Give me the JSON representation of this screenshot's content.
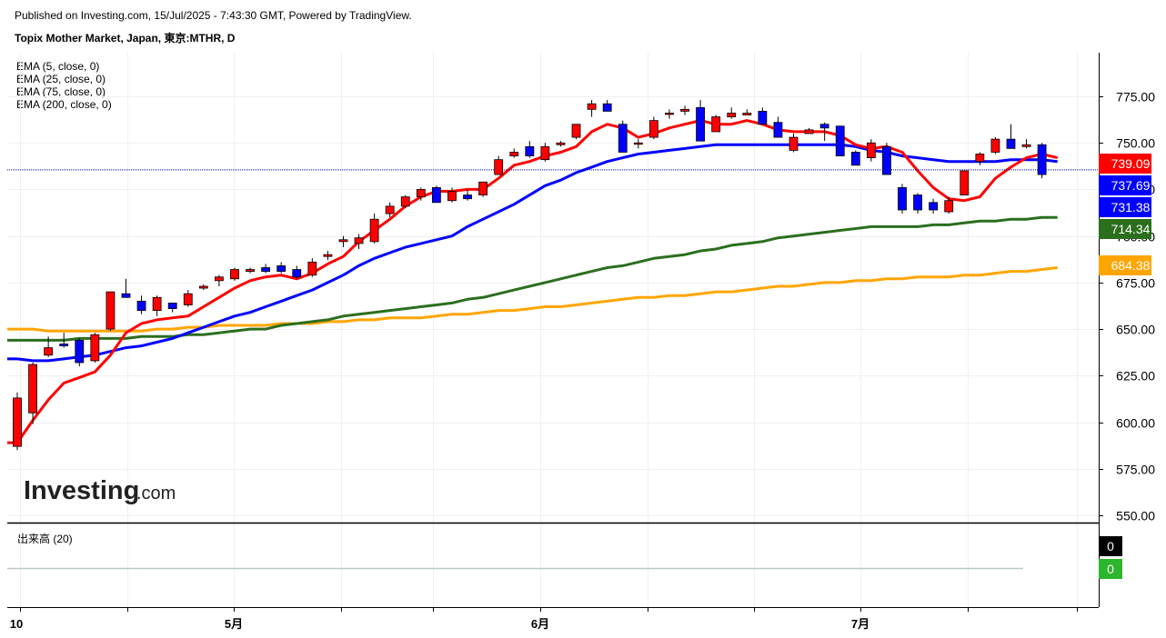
{
  "header": {
    "published": "Published on Investing.com, 15/Jul/2025 - 7:43:30 GMT, Powered by TradingView.",
    "symbol": "Topix Mother Market, Japan, 東京:MTHR, D"
  },
  "watermark": {
    "brand": "Investing",
    "suffix": ".com"
  },
  "legend": [
    "EMA (5, close, 0)",
    "EMA (25, close, 0)",
    "EMA (75, close, 0)",
    "EMA (200, close, 0)"
  ],
  "volume": {
    "label": "出来高 (20)",
    "badges": [
      "0",
      "0"
    ]
  },
  "colors": {
    "up": "#ff0000",
    "down": "#0000ff",
    "ema5": "#ff0000",
    "ema25": "#0000ff",
    "ema75": "#2b6e1e",
    "ema200": "#ffa500",
    "vol_badge_1": "#000000",
    "vol_badge_2": "#2db52d"
  },
  "chart_data": {
    "type": "candlestick",
    "y_ticks": [
      550,
      575,
      600,
      625,
      650,
      675,
      700,
      725,
      750,
      775
    ],
    "y_tick_labels": [
      "550.00",
      "575.00",
      "600.00",
      "625.00",
      "650.00",
      "675.00",
      "700.00",
      "725.00",
      "750.00",
      "775.00"
    ],
    "x_labels": [
      {
        "label": "10",
        "date": "2025-04-10"
      },
      {
        "label": "5月",
        "date": "2025-05-01"
      },
      {
        "label": "6月",
        "date": "2025-06-02"
      },
      {
        "label": "7月",
        "date": "2025-07-01"
      }
    ],
    "candles": [
      [
        587,
        616,
        585,
        613
      ],
      [
        605,
        632,
        599,
        631
      ],
      [
        636,
        646,
        635,
        640
      ],
      [
        642,
        648,
        640,
        641
      ],
      [
        644,
        645,
        630,
        632
      ],
      [
        633,
        648,
        632,
        647
      ],
      [
        650,
        670,
        649,
        670
      ],
      [
        669,
        677,
        667,
        667
      ],
      [
        665,
        668,
        658,
        660
      ],
      [
        660,
        668,
        657,
        667
      ],
      [
        664,
        664,
        659,
        661
      ],
      [
        663,
        671,
        662,
        669
      ],
      [
        672,
        674,
        671,
        673
      ],
      [
        676,
        679,
        673,
        678
      ],
      [
        677,
        683,
        676,
        682
      ],
      [
        681,
        683,
        680,
        682
      ],
      [
        683,
        685,
        680,
        681
      ],
      [
        684,
        686,
        680,
        681
      ],
      [
        682,
        684,
        677,
        678
      ],
      [
        679,
        688,
        678,
        686
      ],
      [
        689,
        692,
        687,
        690
      ],
      [
        697,
        700,
        694,
        698
      ],
      [
        696,
        701,
        693,
        699
      ],
      [
        697,
        712,
        696,
        709
      ],
      [
        712,
        718,
        710,
        716
      ],
      [
        716,
        722,
        715,
        721
      ],
      [
        721,
        726,
        719,
        725
      ],
      [
        726,
        727,
        718,
        718
      ],
      [
        719,
        726,
        718,
        724
      ],
      [
        722,
        725,
        719,
        720
      ],
      [
        722,
        729,
        721,
        729
      ],
      [
        733,
        743,
        733,
        741
      ],
      [
        743,
        747,
        742,
        745
      ],
      [
        748,
        751,
        742,
        743
      ],
      [
        741,
        750,
        740,
        748
      ],
      [
        749,
        751,
        748,
        750
      ],
      [
        753,
        760,
        752,
        760
      ],
      [
        768,
        773,
        764,
        771
      ],
      [
        771,
        773,
        767,
        767
      ],
      [
        760,
        762,
        745,
        745
      ],
      [
        750,
        752,
        747,
        750
      ],
      [
        753,
        764,
        752,
        762
      ],
      [
        766,
        768,
        763,
        766
      ],
      [
        767,
        770,
        765,
        768
      ],
      [
        769,
        773,
        751,
        751
      ],
      [
        756,
        765,
        756,
        764
      ],
      [
        764,
        769,
        763,
        766
      ],
      [
        765,
        768,
        765,
        766
      ],
      [
        767,
        769,
        760,
        760
      ],
      [
        761,
        764,
        753,
        753
      ],
      [
        746,
        755,
        745,
        753
      ],
      [
        755,
        758,
        755,
        757
      ],
      [
        760,
        761,
        751,
        758
      ],
      [
        759,
        759,
        743,
        743
      ],
      [
        745,
        746,
        738,
        738
      ],
      [
        742,
        752,
        740,
        750
      ],
      [
        748,
        750,
        733,
        733
      ],
      [
        726,
        728,
        712,
        714
      ],
      [
        722,
        723,
        712,
        714
      ],
      [
        718,
        720,
        712,
        714
      ],
      [
        713,
        721,
        712,
        719
      ],
      [
        722,
        735,
        722,
        735
      ],
      [
        740,
        745,
        738,
        744
      ],
      [
        745,
        753,
        744,
        752
      ],
      [
        752,
        760,
        749,
        747
      ],
      [
        748,
        752,
        747,
        749
      ],
      [
        749,
        750,
        731,
        733
      ]
    ],
    "ema5": [
      589,
      601,
      612,
      621,
      624,
      627,
      636,
      648,
      653,
      655,
      656,
      657,
      662,
      667,
      672,
      676,
      678,
      679,
      677,
      680,
      685,
      689,
      697,
      703,
      709,
      716,
      721,
      724,
      724,
      725,
      725,
      731,
      738,
      740,
      743,
      745,
      748,
      756,
      760,
      758,
      753,
      755,
      758,
      760,
      762,
      760,
      760,
      762,
      760,
      757,
      756,
      756,
      756,
      754,
      749,
      747,
      748,
      745,
      735,
      726,
      720,
      719,
      721,
      731,
      737,
      742,
      744,
      742
    ],
    "ema25": [
      634,
      633,
      633,
      634,
      635,
      636,
      638,
      640,
      641,
      643,
      645,
      648,
      651,
      654,
      657,
      659,
      662,
      665,
      668,
      671,
      675,
      679,
      684,
      688,
      691,
      694,
      696,
      698,
      700,
      705,
      709,
      713,
      717,
      722,
      727,
      730,
      734,
      737,
      740,
      742,
      744,
      745,
      746,
      747,
      748,
      749,
      749,
      749,
      749,
      749,
      749,
      749,
      749,
      749,
      748,
      746,
      745,
      743,
      742,
      741,
      740,
      740,
      740,
      740,
      741,
      741,
      741,
      740
    ],
    "ema75": [
      644,
      644,
      644,
      644,
      645,
      645,
      645,
      645,
      646,
      646,
      646,
      647,
      647,
      648,
      649,
      650,
      650,
      652,
      653,
      654,
      655,
      657,
      658,
      659,
      660,
      661,
      662,
      663,
      664,
      666,
      667,
      669,
      671,
      673,
      675,
      677,
      679,
      681,
      683,
      684,
      686,
      688,
      689,
      690,
      692,
      693,
      695,
      696,
      697,
      699,
      700,
      701,
      702,
      703,
      704,
      705,
      705,
      705,
      705,
      706,
      706,
      707,
      708,
      708,
      709,
      709,
      710,
      710
    ],
    "ema200": [
      650,
      650,
      649,
      649,
      649,
      649,
      649,
      649,
      649,
      650,
      650,
      651,
      651,
      652,
      652,
      652,
      652,
      653,
      653,
      653,
      654,
      654,
      655,
      655,
      656,
      656,
      656,
      657,
      658,
      658,
      659,
      660,
      660,
      661,
      662,
      662,
      663,
      664,
      665,
      666,
      667,
      667,
      668,
      668,
      669,
      670,
      670,
      671,
      672,
      673,
      673,
      674,
      675,
      675,
      676,
      676,
      677,
      677,
      678,
      678,
      678,
      679,
      679,
      680,
      681,
      681,
      682,
      683
    ],
    "price_labels": [
      {
        "value": 739.09,
        "text": "739.09",
        "color": "#ff0000"
      },
      {
        "value": 737.69,
        "text": "737.69",
        "color": "#0000ff"
      },
      {
        "value": 731.38,
        "text": "731.38",
        "color": "#0000ff"
      },
      {
        "value": 714.34,
        "text": "714.34",
        "color": "#2b6e1e"
      },
      {
        "value": 684.38,
        "text": "684.38",
        "color": "#ffa500"
      }
    ],
    "last_price_line": 735.5
  }
}
